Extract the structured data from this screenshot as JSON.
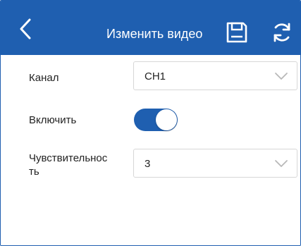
{
  "header": {
    "title": "Изменить видео",
    "back_icon": "chevron-left-icon",
    "save_icon": "floppy-disk-icon",
    "refresh_icon": "refresh-icon",
    "background_color": "#1f5fb0"
  },
  "form": {
    "channel": {
      "label": "Канал",
      "value": "CH1"
    },
    "enable": {
      "label": "Включить",
      "checked": true,
      "accent_color": "#1f5fb0"
    },
    "sensitivity": {
      "label_line1": "Чувствительнос",
      "label_line2": "ть",
      "value": "3"
    }
  }
}
